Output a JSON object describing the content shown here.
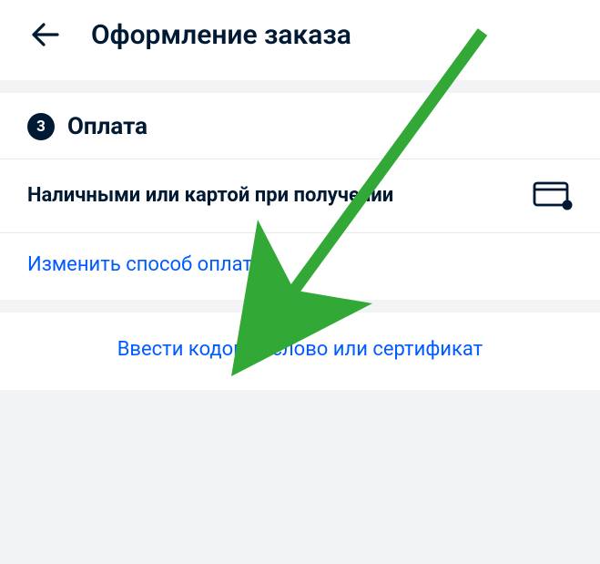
{
  "header": {
    "title": "Оформление заказа"
  },
  "payment": {
    "step_number": "3",
    "section_title": "Оплата",
    "method_text": "Наличными или картой при получении",
    "change_link": "Изменить способ оплаты"
  },
  "certificate": {
    "link_text": "Ввести кодовое слово или сертификат"
  }
}
